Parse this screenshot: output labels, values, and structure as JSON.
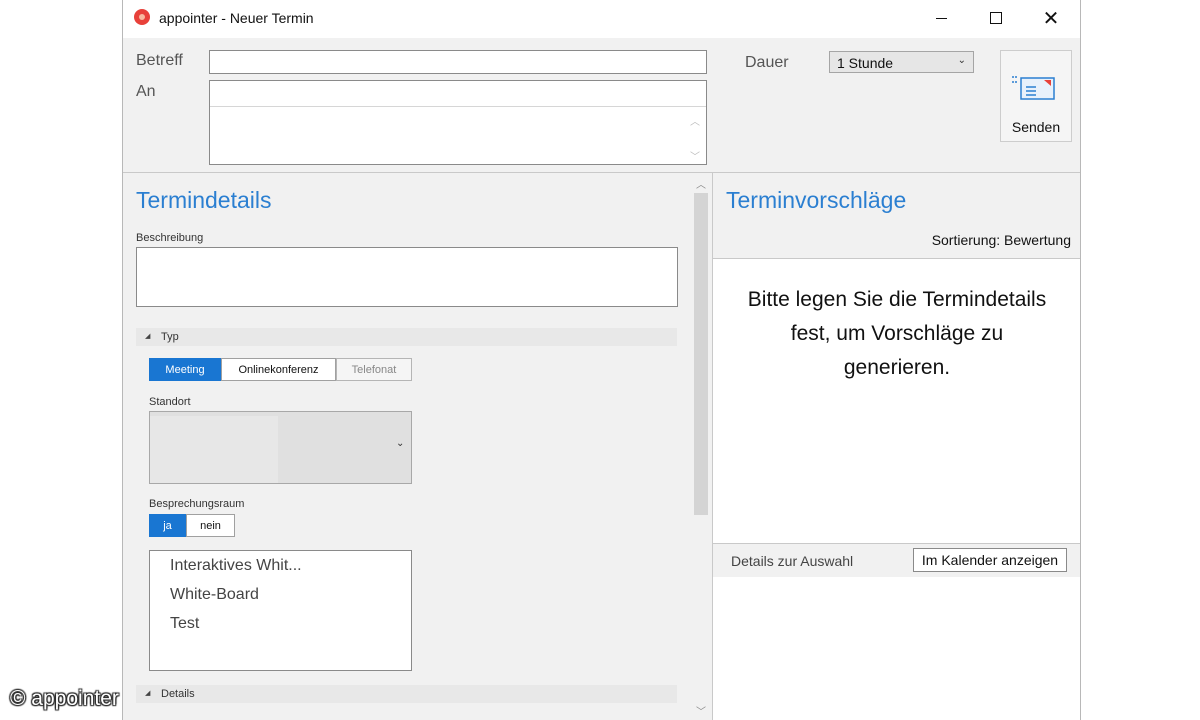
{
  "window": {
    "title": "appointer - Neuer Termin",
    "accent": "#1976d2",
    "heading_color": "#2b7fd1"
  },
  "header": {
    "betreff_label": "Betreff",
    "betreff_value": "",
    "an_label": "An",
    "an_value": "",
    "dauer_label": "Dauer",
    "dauer_value": "1 Stunde",
    "send_label": "Senden",
    "send_icon": "envelope-send-icon"
  },
  "details": {
    "title": "Termindetails",
    "beschreibung_label": "Beschreibung",
    "beschreibung_value": "",
    "typ_group": "Typ",
    "typ_options": [
      "Meeting",
      "Onlinekonferenz",
      "Telefonat"
    ],
    "typ_selected": "Meeting",
    "standort_label": "Standort",
    "standort_value": "",
    "raum_label": "Besprechungsraum",
    "raum_options": [
      "ja",
      "nein"
    ],
    "raum_selected": "ja",
    "equipment": [
      "Interaktives Whit...",
      "White-Board",
      "Test"
    ],
    "details_group": "Details"
  },
  "suggestions": {
    "title": "Terminvorschläge",
    "sort_label": "Sortierung: Bewertung",
    "hint": "Bitte legen Sie die Termindetails fest, um Vorschläge zu generieren.",
    "details_label": "Details zur Auswahl",
    "calendar_button": "Im Kalender anzeigen"
  },
  "watermark": "© appointer"
}
